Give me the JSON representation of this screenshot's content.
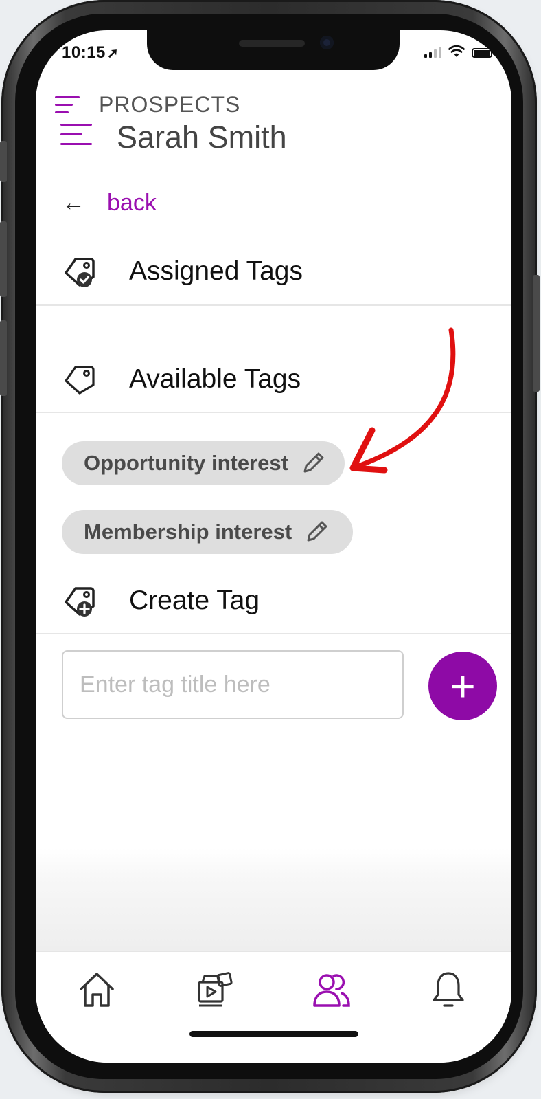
{
  "status_bar": {
    "time": "10:15",
    "location_icon": "location-arrow-icon"
  },
  "header": {
    "section": "PROSPECTS",
    "name": "Sarah Smith",
    "menu_icon": "hamburger-menu-icon"
  },
  "navigation": {
    "back_label": "back",
    "back_icon": "arrow-left-icon"
  },
  "sections": {
    "assigned": {
      "title": "Assigned Tags",
      "icon": "tag-check-icon"
    },
    "available": {
      "title": "Available Tags",
      "icon": "tag-icon"
    },
    "create": {
      "title": "Create Tag",
      "icon": "tag-plus-icon"
    }
  },
  "available_tags": [
    {
      "label": "Opportunity interest",
      "icon": "pencil-icon"
    },
    {
      "label": "Membership interest",
      "icon": "pencil-icon"
    }
  ],
  "create_form": {
    "placeholder": "Enter tag title here",
    "add_label": "+"
  },
  "bottom_nav": [
    {
      "name": "home",
      "icon": "home-icon",
      "active": false
    },
    {
      "name": "media",
      "icon": "media-icon",
      "active": false
    },
    {
      "name": "people",
      "icon": "people-icon",
      "active": true
    },
    {
      "name": "notifications",
      "icon": "bell-icon",
      "active": false
    }
  ],
  "colors": {
    "accent": "#9a0fb0",
    "chip_bg": "#dedede",
    "annotation": "#e01010"
  }
}
